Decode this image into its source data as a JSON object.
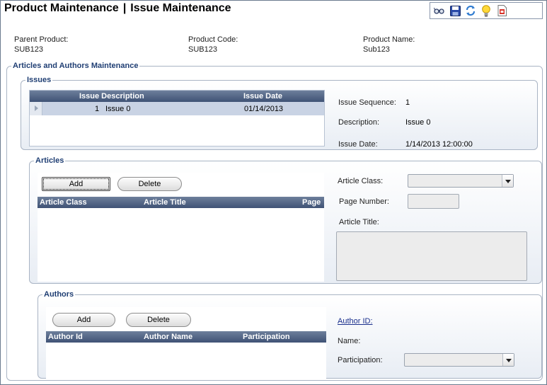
{
  "page": {
    "title_left": "Product Maintenance",
    "title_sep": "|",
    "title_right": "Issue Maintenance"
  },
  "toolbar": {
    "icons": [
      "glasses-icon",
      "save-icon",
      "refresh-icon",
      "lightbulb-icon",
      "report-icon"
    ]
  },
  "header": {
    "parent_product_label": "Parent Product:",
    "parent_product_value": "SUB123",
    "product_code_label": "Product Code:",
    "product_code_value": "SUB123",
    "product_name_label": "Product Name:",
    "product_name_value": "Sub123"
  },
  "outer_group": {
    "title": "Articles and Authors Maintenance"
  },
  "issues": {
    "title": "Issues",
    "columns": [
      "Issue Description",
      "Issue Date"
    ],
    "rows": [
      {
        "num": "1",
        "description": "Issue 0",
        "date": "01/14/2013"
      }
    ],
    "detail": {
      "sequence_label": "Issue Sequence:",
      "sequence_value": "1",
      "description_label": "Description:",
      "description_value": "Issue 0",
      "date_label": "Issue Date:",
      "date_value": "1/14/2013 12:00:00"
    }
  },
  "articles": {
    "title": "Articles",
    "add_label": "Add",
    "delete_label": "Delete",
    "columns": [
      "Article Class",
      "Article Title",
      "Page"
    ],
    "class_label": "Article Class:",
    "page_number_label": "Page Number:",
    "article_title_label": "Article Title:"
  },
  "authors": {
    "title": "Authors",
    "add_label": "Add",
    "delete_label": "Delete",
    "columns": [
      "Author Id",
      "Author Name",
      "Participation"
    ],
    "author_id_label": "Author ID:",
    "name_label": "Name:",
    "participation_label": "Participation:"
  }
}
